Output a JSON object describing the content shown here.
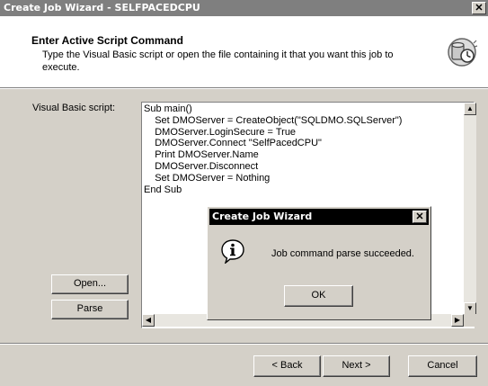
{
  "window": {
    "title": "Create Job Wizard - SELFPACEDCPU",
    "close_glyph": "✕"
  },
  "header": {
    "heading": "Enter Active Script Command",
    "description": "Type the Visual Basic script or open the file containing it that you want this job to execute.",
    "icon": "script-wizard-icon"
  },
  "editor": {
    "label": "Visual Basic script:",
    "script": "Sub main()\n    Set DMOServer = CreateObject(\"SQLDMO.SQLServer\")\n    DMOServer.LoginSecure = True\n    DMOServer.Connect \"SelfPacedCPU\"\n    Print DMOServer.Name\n    DMOServer.Disconnect\n    Set DMOServer = Nothing\nEnd Sub"
  },
  "side_buttons": {
    "open_label": "Open...",
    "parse_label": "Parse"
  },
  "footer": {
    "back_label": "< Back",
    "next_label": "Next >",
    "cancel_label": "Cancel"
  },
  "dialog": {
    "title": "Create Job Wizard",
    "close_glyph": "✕",
    "message": "Job command parse succeeded.",
    "ok_label": "OK",
    "icon": "information-icon"
  },
  "colors": {
    "face": "#d4d0c8",
    "inactive_title": "#7f7f7f",
    "active_title": "#000000"
  }
}
